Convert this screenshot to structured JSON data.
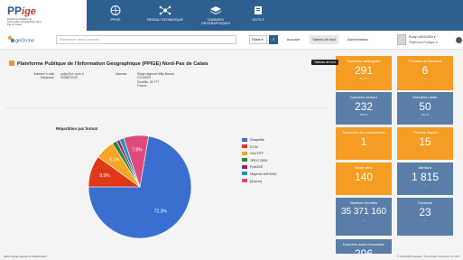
{
  "brand": {
    "logo_pp": "PP",
    "logo_ige": "ige",
    "logo_sub": "Plateforme Publique de l'Information Géographique Nord-Pas de Calais"
  },
  "navbar": {
    "items": [
      "PPIGE",
      "RESEAU GEOMATIQUE",
      "DONNEES GEOGRAPHIQUES",
      "OUTILS"
    ]
  },
  "toolbar": {
    "logo": "geOrchestra",
    "search_placeholder": "Rechercher dans l'annuaire...",
    "filters_label": "Filtres ▾",
    "links": [
      "Annuaire",
      "Tableau de bord",
      "Administration"
    ],
    "active_link": "Tableau de bord",
    "tooltip": "Tableau de bord"
  },
  "user": {
    "name": "Rudy LIMOUSIN ▾",
    "org": "Plateforme Publique d..."
  },
  "org": {
    "title": "Plateforme Publique de l'Information Géographique (PPIGE) Nord-Pas de Calais",
    "email_label": "Adresse e-mail",
    "email_value": "ppige@cr-npdc.fr",
    "phone_label": "Téléphone",
    "phone_value": "0328872030",
    "address_label": "Adresse",
    "address_lines": [
      "Siège régional Willy Brandt",
      "CS 20003",
      "Euralille, 59 777",
      "France"
    ]
  },
  "chart_data": {
    "type": "pie",
    "title": "Répartition par format",
    "categories": [
      "Shapefile",
      "ECW",
      "GeoTIFF",
      "JPEG 2000",
      "PostGIS",
      "MapInfo MIF/MID",
      "[Aucun]"
    ],
    "values": [
      72.3,
      9.9,
      6.1,
      1.5,
      1.0,
      1.4,
      7.8
    ],
    "labels": [
      "72.3%",
      "9.9%",
      "6.1%",
      "",
      "",
      "",
      "7.8%"
    ],
    "colors": [
      "#3b6fcf",
      "#e0391a",
      "#f5a623",
      "#2a8a2e",
      "#a01c83",
      "#1a98b5",
      "#e04a7a"
    ],
    "legend_position": "right"
  },
  "tiles": [
    {
      "label": "Données catalogues",
      "value": "291",
      "sub": "86.1 %",
      "color": "orange"
    },
    {
      "label": "Formats de données",
      "value": "6",
      "sub": "—",
      "color": "orange"
    },
    {
      "label": "Données vecteur",
      "value": "232",
      "sub": "79.8 %",
      "color": "blue"
    },
    {
      "label": "Données raster",
      "value": "50",
      "sub": "16.9 %",
      "color": "blue"
    },
    {
      "label": "Systèmes de coordonnées",
      "value": "1",
      "sub": "—",
      "color": "orange"
    },
    {
      "label": "Thèmes Inspire",
      "value": "15",
      "sub": "—",
      "color": "orange"
    },
    {
      "label": "Mode sites",
      "value": "140",
      "sub": "—",
      "color": "orange"
    },
    {
      "label": "Attributs",
      "value": "1 815",
      "sub": "—",
      "color": "blue"
    },
    {
      "label": "Nombre d'entités",
      "value": "35 371 160",
      "sub": "—",
      "color": "blue"
    },
    {
      "label": "Contacts",
      "value": "23",
      "sub": "—",
      "color": "blue"
    },
    {
      "label": "Données dans l'inventaire",
      "value": "296",
      "sub": "—",
      "color": "blue"
    }
  ],
  "status": {
    "url": "https://ppige.geopal.com/dashboard",
    "footer": "© 2014-2016 geopal - Tous droits réservés | v2.13.0"
  }
}
